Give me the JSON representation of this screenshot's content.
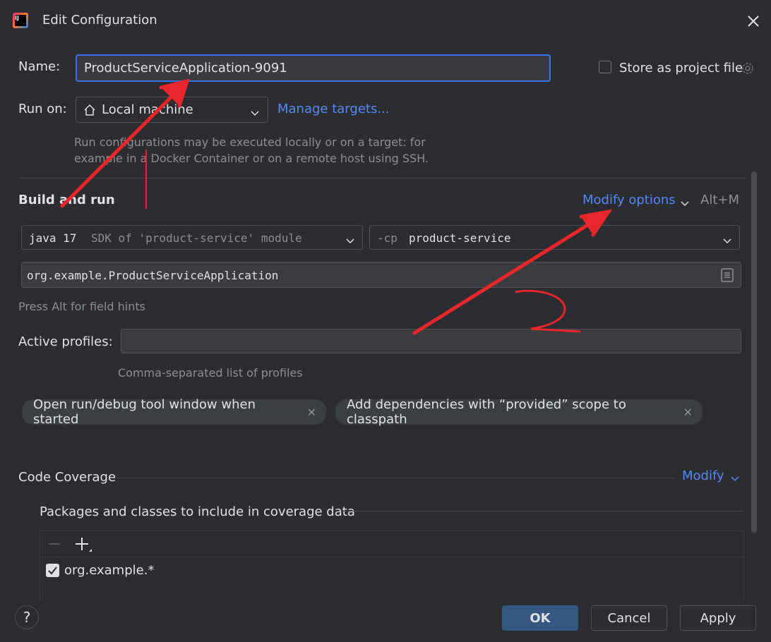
{
  "window": {
    "title": "Edit Configuration",
    "app_icon_letters": "IJ"
  },
  "name_row": {
    "label": "Name:",
    "value": "ProductServiceApplication-9091",
    "store_label": "Store as project file"
  },
  "run_on": {
    "label": "Run on:",
    "value": "Local machine",
    "manage_link": "Manage targets...",
    "hint_line1": "Run configurations may be executed locally or on a target: for",
    "hint_line2": "example in a Docker Container or on a remote host using SSH."
  },
  "build_run": {
    "title": "Build and run",
    "modify_options": "Modify options",
    "shortcut": "Alt+M",
    "sdk_name": "java 17",
    "sdk_hint": "SDK of 'product-service' module",
    "cp_prefix": "-cp",
    "cp_value": "product-service",
    "main_class": "org.example.ProductServiceApplication",
    "field_hint": "Press Alt for field hints"
  },
  "profiles": {
    "label": "Active profiles:",
    "value": "",
    "hint": "Comma-separated list of profiles"
  },
  "chips": [
    "Open run/debug tool window when started",
    "Add dependencies with “provided” scope to classpath"
  ],
  "coverage": {
    "title": "Code Coverage",
    "modify": "Modify",
    "packages_title": "Packages and classes to include in coverage data",
    "items": [
      {
        "pattern": "org.example.*",
        "checked": true
      }
    ]
  },
  "buttons": {
    "help": "?",
    "ok": "OK",
    "cancel": "Cancel",
    "apply": "Apply"
  },
  "annotation_label": "2",
  "colors": {
    "background": "#2b2d30",
    "accent": "#548af7",
    "ok_button": "#365880",
    "annotation": "#e8262b"
  }
}
